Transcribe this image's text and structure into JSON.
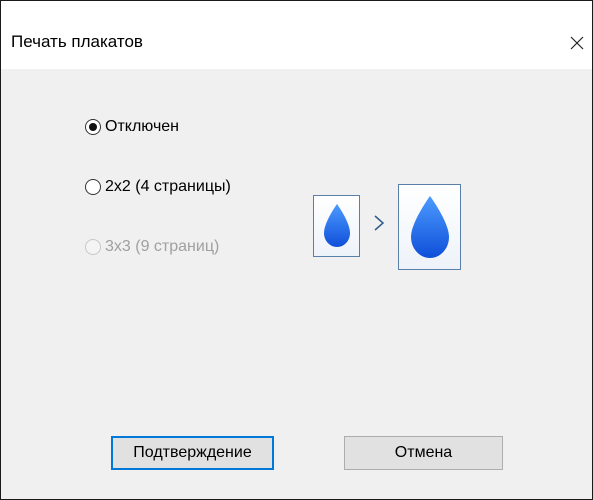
{
  "window": {
    "title": "Печать плакатов"
  },
  "options": [
    {
      "label": "Отключен",
      "checked": true,
      "enabled": true
    },
    {
      "label": "2x2 (4 страницы)",
      "checked": false,
      "enabled": true
    },
    {
      "label": "3x3 (9 страниц)",
      "checked": false,
      "enabled": false
    }
  ],
  "preview": {
    "source_icon": "water-drop-icon",
    "target_icon": "water-drop-icon",
    "arrow_icon": "chevron-right-icon",
    "drop_color": "#1f6ff0"
  },
  "buttons": {
    "confirm_label": "Подтверждение",
    "cancel_label": "Отмена"
  },
  "colors": {
    "accent_focus": "#0078d7",
    "dialog_background": "#f0f0f0",
    "title_background": "#ffffff",
    "disabled_text": "#a0a0a0"
  }
}
